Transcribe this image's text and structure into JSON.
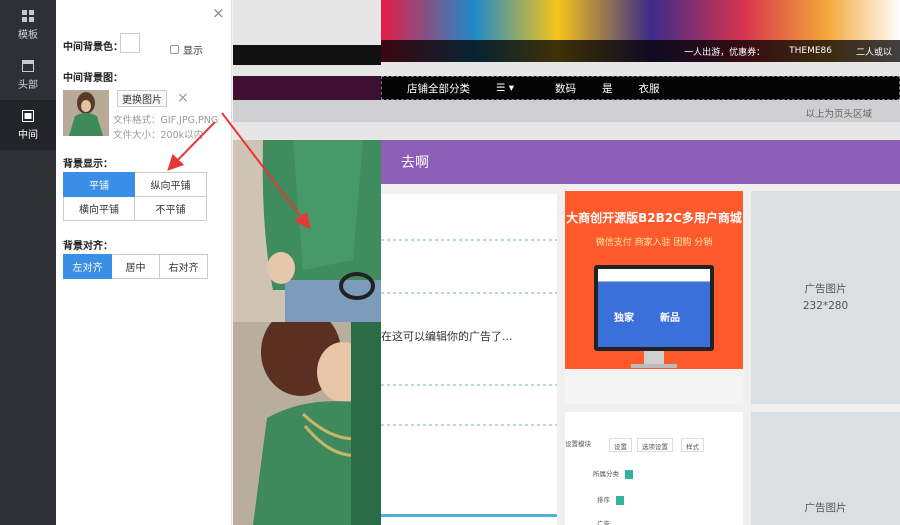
{
  "rail": {
    "items": [
      {
        "label": "模板",
        "icon": "template-grid-icon",
        "active": false
      },
      {
        "label": "头部",
        "icon": "header-window-icon",
        "active": false
      },
      {
        "label": "中间",
        "icon": "middle-layout-icon",
        "active": true
      }
    ]
  },
  "panel": {
    "bg_color_label": "中间背景色：",
    "show_label": "显示",
    "bg_image_label": "中间背景图：",
    "replace_button": "更换图片",
    "file_format": "文件格式：GIF,JPG,PNG",
    "file_size": "文件大小：200k以内",
    "bg_display_label": "背景显示：",
    "display_options": [
      {
        "label": "平铺",
        "selected": true
      },
      {
        "label": "纵向平铺",
        "selected": false
      },
      {
        "label": "横向平铺",
        "selected": false
      },
      {
        "label": "不平铺",
        "selected": false
      }
    ],
    "bg_align_label": "背景对齐：",
    "align_options": [
      {
        "label": "左对齐",
        "selected": true
      },
      {
        "label": "居中",
        "selected": false
      },
      {
        "label": "右对齐",
        "selected": false
      }
    ]
  },
  "preview": {
    "banner_ticker": [
      "一人出游，优惠券：",
      "THEME86",
      "二人或以"
    ],
    "nav_items": [
      "店铺全部分类",
      "☰ ▾",
      "数码",
      "是",
      "衣服"
    ],
    "head_hint": "以上为页头区域",
    "section_title": "去啊",
    "blurry_text": "在这可以编辑你的广告了...",
    "ad_b2b": {
      "title": "大商创开源版B2B2C多用户商城",
      "subtitle": "微信支付 商家入驻 团购 分销",
      "tag_left": "独家",
      "tag_right": "新品"
    },
    "ad_placeholder_1": {
      "label": "广告图片",
      "size": "232*280"
    },
    "ad_placeholder_2": {
      "label": "广告图片"
    },
    "mini_panel": {
      "title": "设置模块",
      "tabs": [
        "设置",
        "选项设置",
        "样式"
      ],
      "row1": "所属分类",
      "row2": "排序",
      "row3": "广告"
    }
  },
  "colors": {
    "accent_blue": "#3a8ee6",
    "section_purple": "#8d5db8",
    "arrow_red": "#e53935"
  }
}
